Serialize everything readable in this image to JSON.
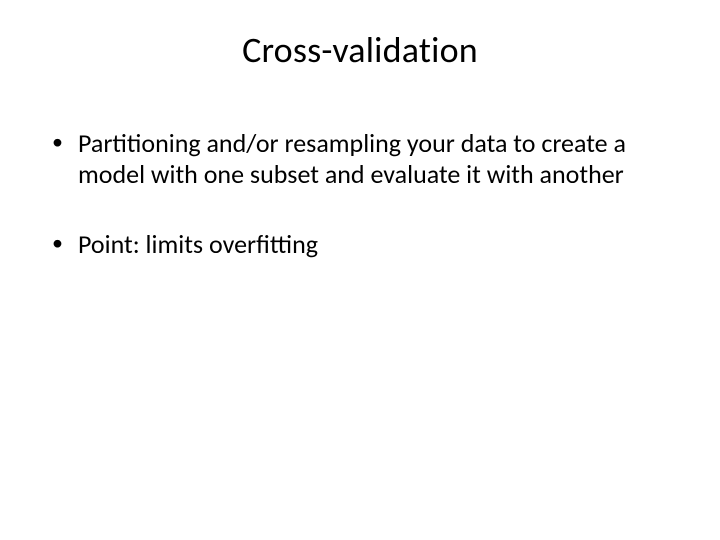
{
  "slide": {
    "title": "Cross-validation",
    "bullets": [
      "Partitioning and/or resampling your data to create a model with one subset and evaluate it with another",
      "Point: limits overfitting"
    ]
  }
}
